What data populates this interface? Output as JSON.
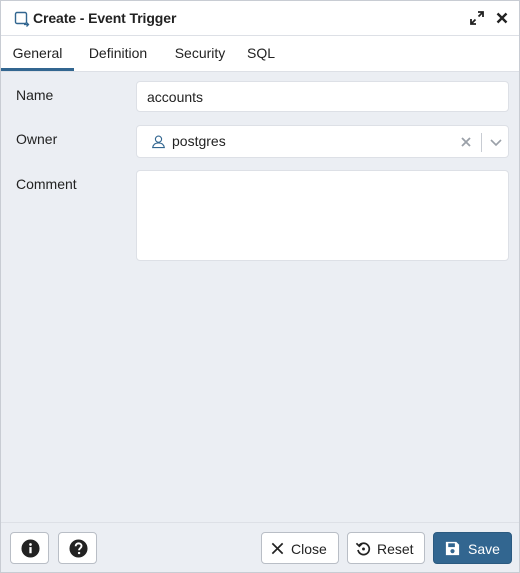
{
  "dialog": {
    "title": "Create - Event Trigger"
  },
  "tabs": [
    {
      "label": "General",
      "active": true
    },
    {
      "label": "Definition",
      "active": false
    },
    {
      "label": "Security",
      "active": false
    },
    {
      "label": "SQL",
      "active": false
    }
  ],
  "form": {
    "name": {
      "label": "Name",
      "value": "accounts"
    },
    "owner": {
      "label": "Owner",
      "value": "postgres",
      "icon": "user-icon"
    },
    "comment": {
      "label": "Comment",
      "value": ""
    }
  },
  "footer": {
    "info_icon": "info-icon",
    "help_icon": "help-icon",
    "close_label": "Close",
    "reset_label": "Reset",
    "save_label": "Save"
  },
  "colors": {
    "accent": "#326690",
    "background": "#ebeef3",
    "border": "#dde0e6",
    "text": "#222222"
  }
}
